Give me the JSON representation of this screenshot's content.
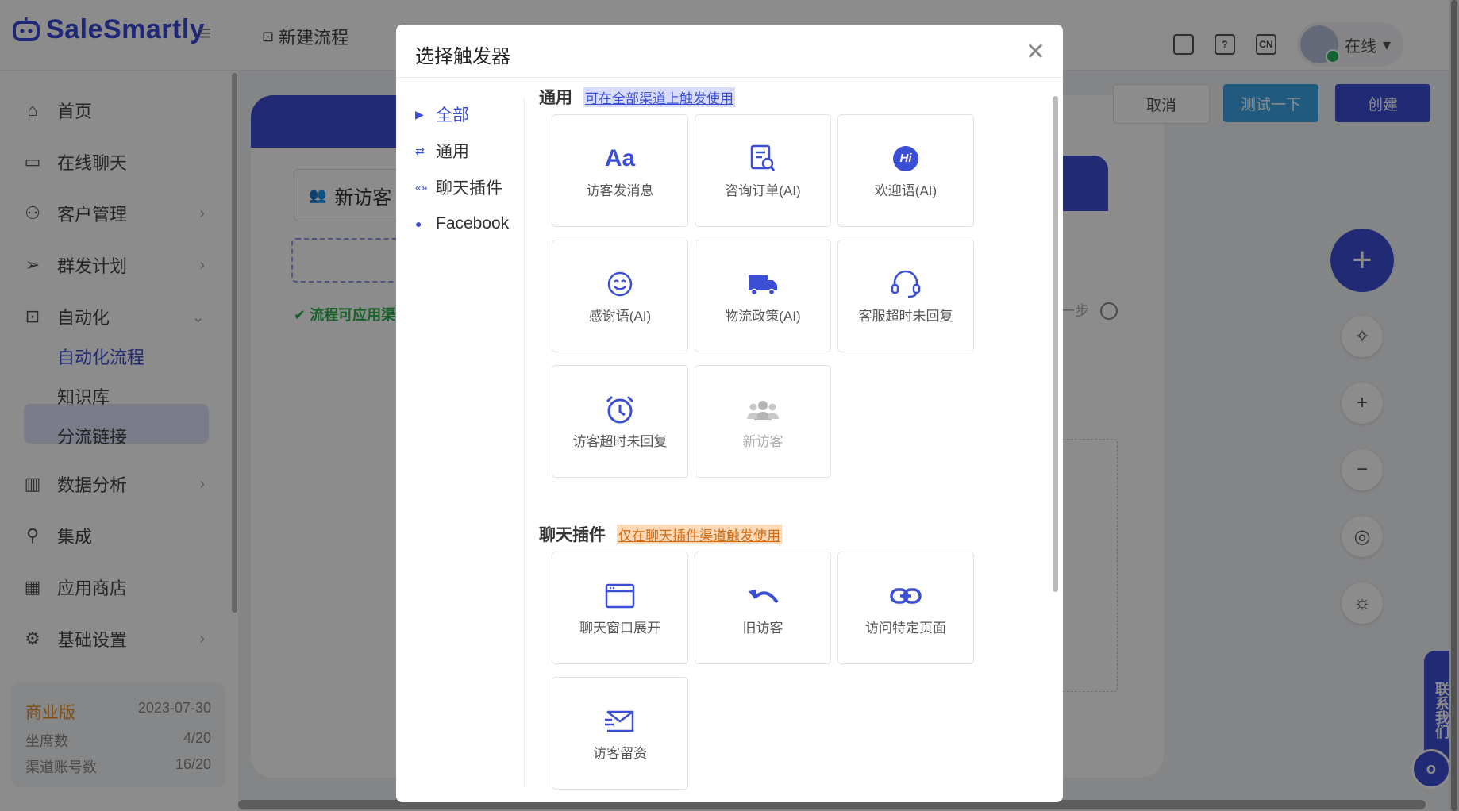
{
  "app": {
    "brand": "SaleSmartly"
  },
  "header": {
    "breadcrumb": "新建流程",
    "user_status": "在线",
    "lang_badge": "CN"
  },
  "sidebar": {
    "items": [
      {
        "label": "首页",
        "icon": "home-icon"
      },
      {
        "label": "在线聊天",
        "icon": "chat-icon"
      },
      {
        "label": "客户管理",
        "icon": "users-icon"
      },
      {
        "label": "群发计划",
        "icon": "send-icon"
      },
      {
        "label": "自动化",
        "icon": "robot-icon"
      },
      {
        "label": "数据分析",
        "icon": "analytics-icon"
      },
      {
        "label": "集成",
        "icon": "integration-icon"
      },
      {
        "label": "应用商店",
        "icon": "app-store-icon"
      },
      {
        "label": "基础设置",
        "icon": "settings-icon"
      }
    ],
    "sub_items": [
      "自动化流程",
      "知识库",
      "分流链接"
    ],
    "plan": {
      "name": "商业版",
      "expiry": "2023-07-30",
      "seats_label": "坐席数",
      "seats_value": "4/20",
      "channels_label": "渠道账号数",
      "channels_value": "16/20"
    }
  },
  "canvas": {
    "trigger_label": "新访客",
    "status_text": "流程可应用渠",
    "next_step": "一步",
    "buttons": {
      "cancel": "取消",
      "test": "测试一下",
      "create": "创建"
    },
    "contact_label": "联系我们"
  },
  "modal": {
    "title": "选择触发器",
    "nav": [
      {
        "label": "全部",
        "icon": "triangle-right-icon",
        "active": true
      },
      {
        "label": "通用",
        "icon": "swap-icon",
        "active": false
      },
      {
        "label": "聊天插件",
        "icon": "plugin-icon",
        "active": false
      },
      {
        "label": "Facebook",
        "icon": "messenger-icon",
        "active": false
      }
    ],
    "sections": [
      {
        "title": "通用",
        "tag": "可在全部渠道上触发使用",
        "tiles": [
          {
            "label": "访客发消息",
            "icon": "text-aa-icon",
            "disabled": false
          },
          {
            "label": "咨询订单(AI)",
            "icon": "document-search-icon",
            "disabled": false
          },
          {
            "label": "欢迎语(AI)",
            "icon": "hi-badge-icon",
            "disabled": false
          },
          {
            "label": "感谢语(AI)",
            "icon": "smile-icon",
            "disabled": false
          },
          {
            "label": "物流政策(AI)",
            "icon": "truck-icon",
            "disabled": false
          },
          {
            "label": "客服超时未回复",
            "icon": "headset-icon",
            "disabled": false
          },
          {
            "label": "访客超时未回复",
            "icon": "alarm-clock-icon",
            "disabled": false
          },
          {
            "label": "新访客",
            "icon": "group-icon",
            "disabled": true
          }
        ]
      },
      {
        "title": "聊天插件",
        "tag": "仅在聊天插件渠道触发使用",
        "tiles": [
          {
            "label": "聊天窗口展开",
            "icon": "browser-window-icon",
            "disabled": false
          },
          {
            "label": "旧访客",
            "icon": "undo-arrow-icon",
            "disabled": false
          },
          {
            "label": "访问特定页面",
            "icon": "link-icon",
            "disabled": false
          },
          {
            "label": "访客留资",
            "icon": "form-mail-icon",
            "disabled": false
          }
        ]
      }
    ]
  },
  "colors": {
    "primary": "#3b4ed6",
    "accent_blue": "#3ba7e7",
    "success": "#2bb34a",
    "orange": "#e58c20"
  }
}
